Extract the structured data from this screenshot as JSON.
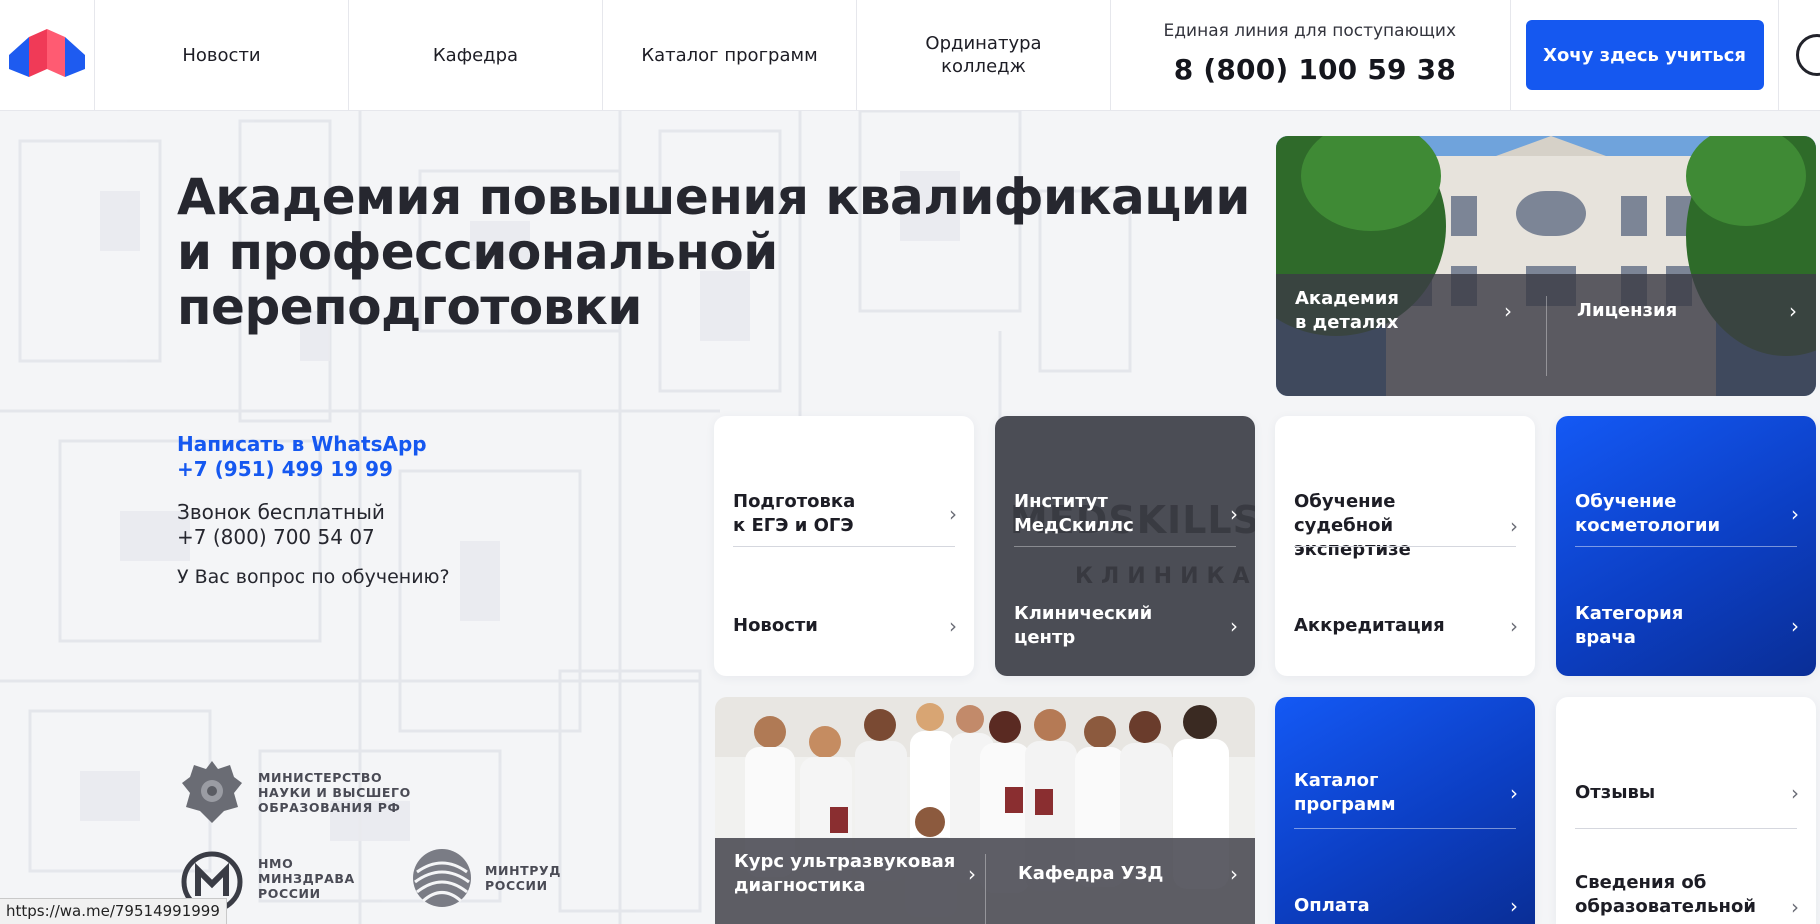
{
  "colors": {
    "accent": "#1558f0",
    "text_dark": "#22232b",
    "tile_dark": "#4b4d55"
  },
  "header": {
    "nav": [
      "Новости",
      "Кафедра",
      "Каталог программ",
      "Ординатура\nколледж"
    ],
    "hotline_caption": "Единая линия для поступающих",
    "hotline_phone": "8 (800) 100 59 38",
    "cta_label": "Хочу здесь учиться"
  },
  "hero": {
    "title_lines": [
      "Академия повышения квалификации",
      "и профессиональной",
      "переподготовки"
    ]
  },
  "contacts": {
    "whatsapp_label": "Написать в WhatsApp",
    "whatsapp_phone": "+7 (951) 499 19 99",
    "free_call_label": "Звонок бесплатный",
    "free_call_phone": "+7 (800) 700 54 07",
    "question": "У Вас вопрос по обучению?"
  },
  "orgs": [
    {
      "icon": "emblem-icon",
      "label": "Министерство\nнауки и высшего\nобразования РФ"
    },
    {
      "icon": "nmo-logo-icon",
      "label": "НМО\nМинздрава\nРоссии"
    },
    {
      "icon": "mintrud-logo-icon",
      "label": "Минтруд\nРоссии"
    }
  ],
  "tiles": {
    "building": {
      "left": "Академия\nв деталях",
      "right": "Лицензия"
    },
    "t1": {
      "top": "Подготовка\nк ЕГЭ и ОГЭ",
      "bottom": "Новости"
    },
    "t2": {
      "top": "Институт\nМедСкиллс",
      "bottom": "Клинический\nцентр",
      "sign_text": "MEDSKILLS",
      "sign_sub": "КЛИНИКА"
    },
    "t3": {
      "top": "Обучение\nсудебной экспертизе",
      "bottom": "Аккредитация"
    },
    "t4": {
      "top": "Обучение\nкосметологии",
      "bottom": "Категория\nврача"
    },
    "group": {
      "left": "Курс ультразвуковая\nдиагностика",
      "right": "Кафедра УЗД"
    },
    "t5": {
      "top": "Каталог\nпрограмм",
      "bottom": "Оплата"
    },
    "t6": {
      "top": "Отзывы",
      "bottom": "Сведения об\nобразовательной\nорганизации"
    }
  },
  "status_url": "https://wa.me/79514991999"
}
